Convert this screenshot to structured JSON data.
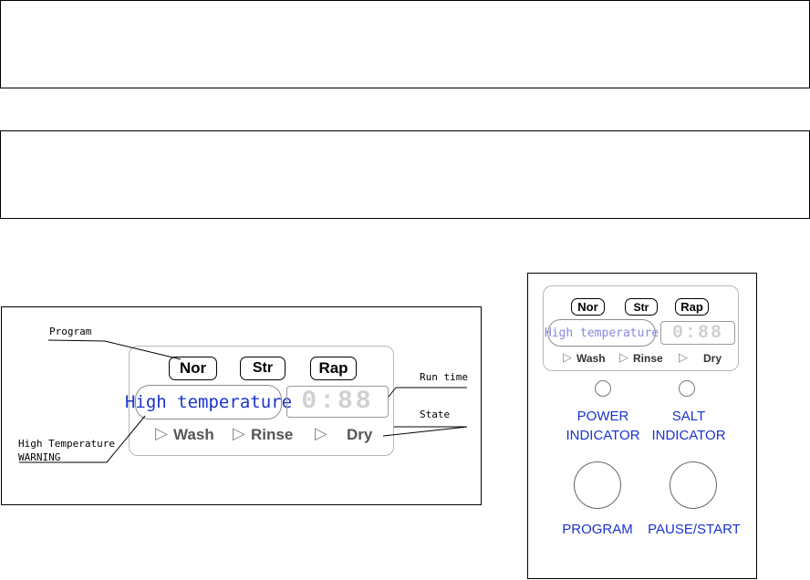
{
  "left_panel": {
    "programs": [
      "Nor",
      "Str",
      "Rap"
    ],
    "warning_text": "High temperature",
    "time_display": "0:88",
    "states": [
      "Wash",
      "Rinse",
      "Dry"
    ]
  },
  "callouts": {
    "program": "Program",
    "run_time": "Run time",
    "state": "State",
    "high_temp_line1": "High Temperature",
    "high_temp_line2": "WARNING"
  },
  "right_panel": {
    "programs": [
      "Nor",
      "Str",
      "Rap"
    ],
    "warning_text": "High temperature",
    "time_display": "0:88",
    "states": [
      "Wash",
      "Rinse",
      "Dry"
    ],
    "power_indicator_line1": "POWER",
    "power_indicator_line2": "INDICATOR",
    "salt_indicator_line1": "SALT",
    "salt_indicator_line2": "INDICATOR",
    "program_button": "PROGRAM",
    "pause_start_button": "PAUSE/START"
  },
  "colors": {
    "label_blue": "#1a33cc",
    "lcd_border": "#b8b8b8"
  }
}
